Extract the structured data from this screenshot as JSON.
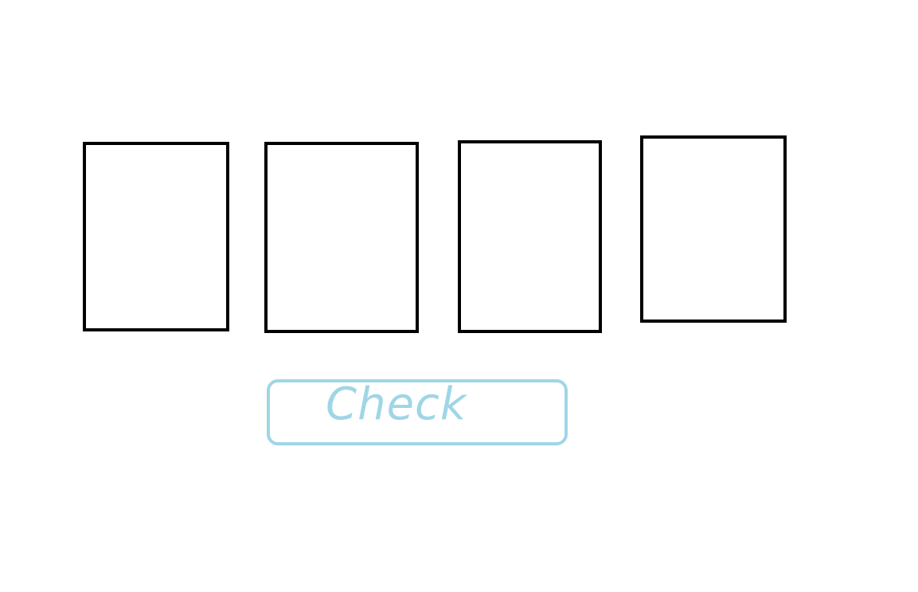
{
  "slots": [
    {
      "id": "slot-1"
    },
    {
      "id": "slot-2"
    },
    {
      "id": "slot-3"
    },
    {
      "id": "slot-4"
    }
  ],
  "check_button": {
    "label": "Check",
    "color": "#9fd6e6"
  },
  "colors": {
    "background": "#ffffff",
    "slot_border": "#000000"
  }
}
